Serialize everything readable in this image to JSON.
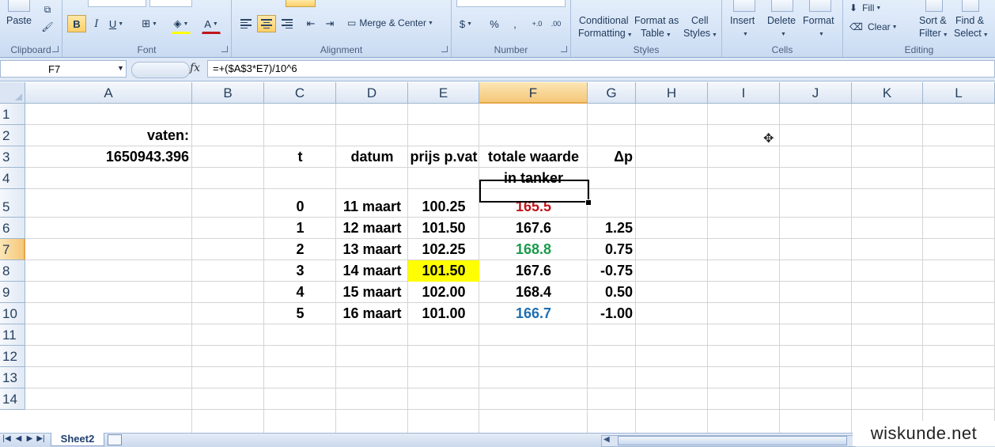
{
  "ribbon": {
    "clipboard": {
      "paste_label": "Paste",
      "group_label": "Clipboard"
    },
    "font": {
      "bold": "B",
      "italic": "I",
      "underline": "U",
      "font_color_glyph": "A",
      "group_label": "Font"
    },
    "alignment": {
      "merge_center_label": "Merge & Center",
      "group_label": "Alignment"
    },
    "number": {
      "currency_glyph": "$",
      "percent_glyph": "%",
      "comma_glyph": ",",
      "inc_decimal_glyph": "+.0",
      "dec_decimal_glyph": ".00",
      "group_label": "Number"
    },
    "styles": {
      "conditional_line1": "Conditional",
      "conditional_line2": "Formatting",
      "format_table_line1": "Format as",
      "format_table_line2": "Table",
      "cell_styles_line1": "Cell",
      "cell_styles_line2": "Styles",
      "group_label": "Styles"
    },
    "cells": {
      "insert_label": "Insert",
      "delete_label": "Delete",
      "format_label": "Format",
      "group_label": "Cells"
    },
    "editing": {
      "fill_label": "Fill",
      "clear_label": "Clear",
      "sort_line1": "Sort &",
      "sort_line2": "Filter",
      "find_line1": "Find &",
      "find_line2": "Select",
      "group_label": "Editing"
    }
  },
  "formula_bar": {
    "name_box": "F7",
    "fx": "fx",
    "formula": "=+($A$3*E7)/10^6"
  },
  "columns": [
    "A",
    "B",
    "C",
    "D",
    "E",
    "F",
    "G",
    "H",
    "I",
    "J",
    "K",
    "L"
  ],
  "rows": [
    "1",
    "2",
    "3",
    "4",
    "5",
    "6",
    "7",
    "8",
    "9",
    "10",
    "11",
    "12",
    "13",
    "14"
  ],
  "cells": {
    "A2": "vaten:",
    "A3": "1650943.396",
    "C3": "t",
    "D3": "datum",
    "E3": "prijs p.vat",
    "F3": "totale waarde",
    "F4": "in tanker",
    "G3": "Δp",
    "table": [
      {
        "t": "0",
        "datum": "11 maart",
        "prijs": "100.25",
        "waarde": "165.5",
        "dp": ""
      },
      {
        "t": "1",
        "datum": "12 maart",
        "prijs": "101.50",
        "waarde": "167.6",
        "dp": "1.25"
      },
      {
        "t": "2",
        "datum": "13 maart",
        "prijs": "102.25",
        "waarde": "168.8",
        "dp": "0.75"
      },
      {
        "t": "3",
        "datum": "14 maart",
        "prijs": "101.50",
        "waarde": "167.6",
        "dp": "-0.75"
      },
      {
        "t": "4",
        "datum": "15 maart",
        "prijs": "102.00",
        "waarde": "168.4",
        "dp": "0.50"
      },
      {
        "t": "5",
        "datum": "16 maart",
        "prijs": "101.00",
        "waarde": "166.7",
        "dp": "-1.00"
      }
    ]
  },
  "colors": {
    "F5": "#c0161a",
    "F7": "#1a9a4a",
    "F10": "#1e6fb3",
    "E8_fill": "#ffff00",
    "selected_header": "#f5c779"
  },
  "selection": {
    "active_column": "F",
    "active_row": "7"
  },
  "sheet_tabs": [
    "Sheet2"
  ],
  "watermark": "wiskunde.net"
}
